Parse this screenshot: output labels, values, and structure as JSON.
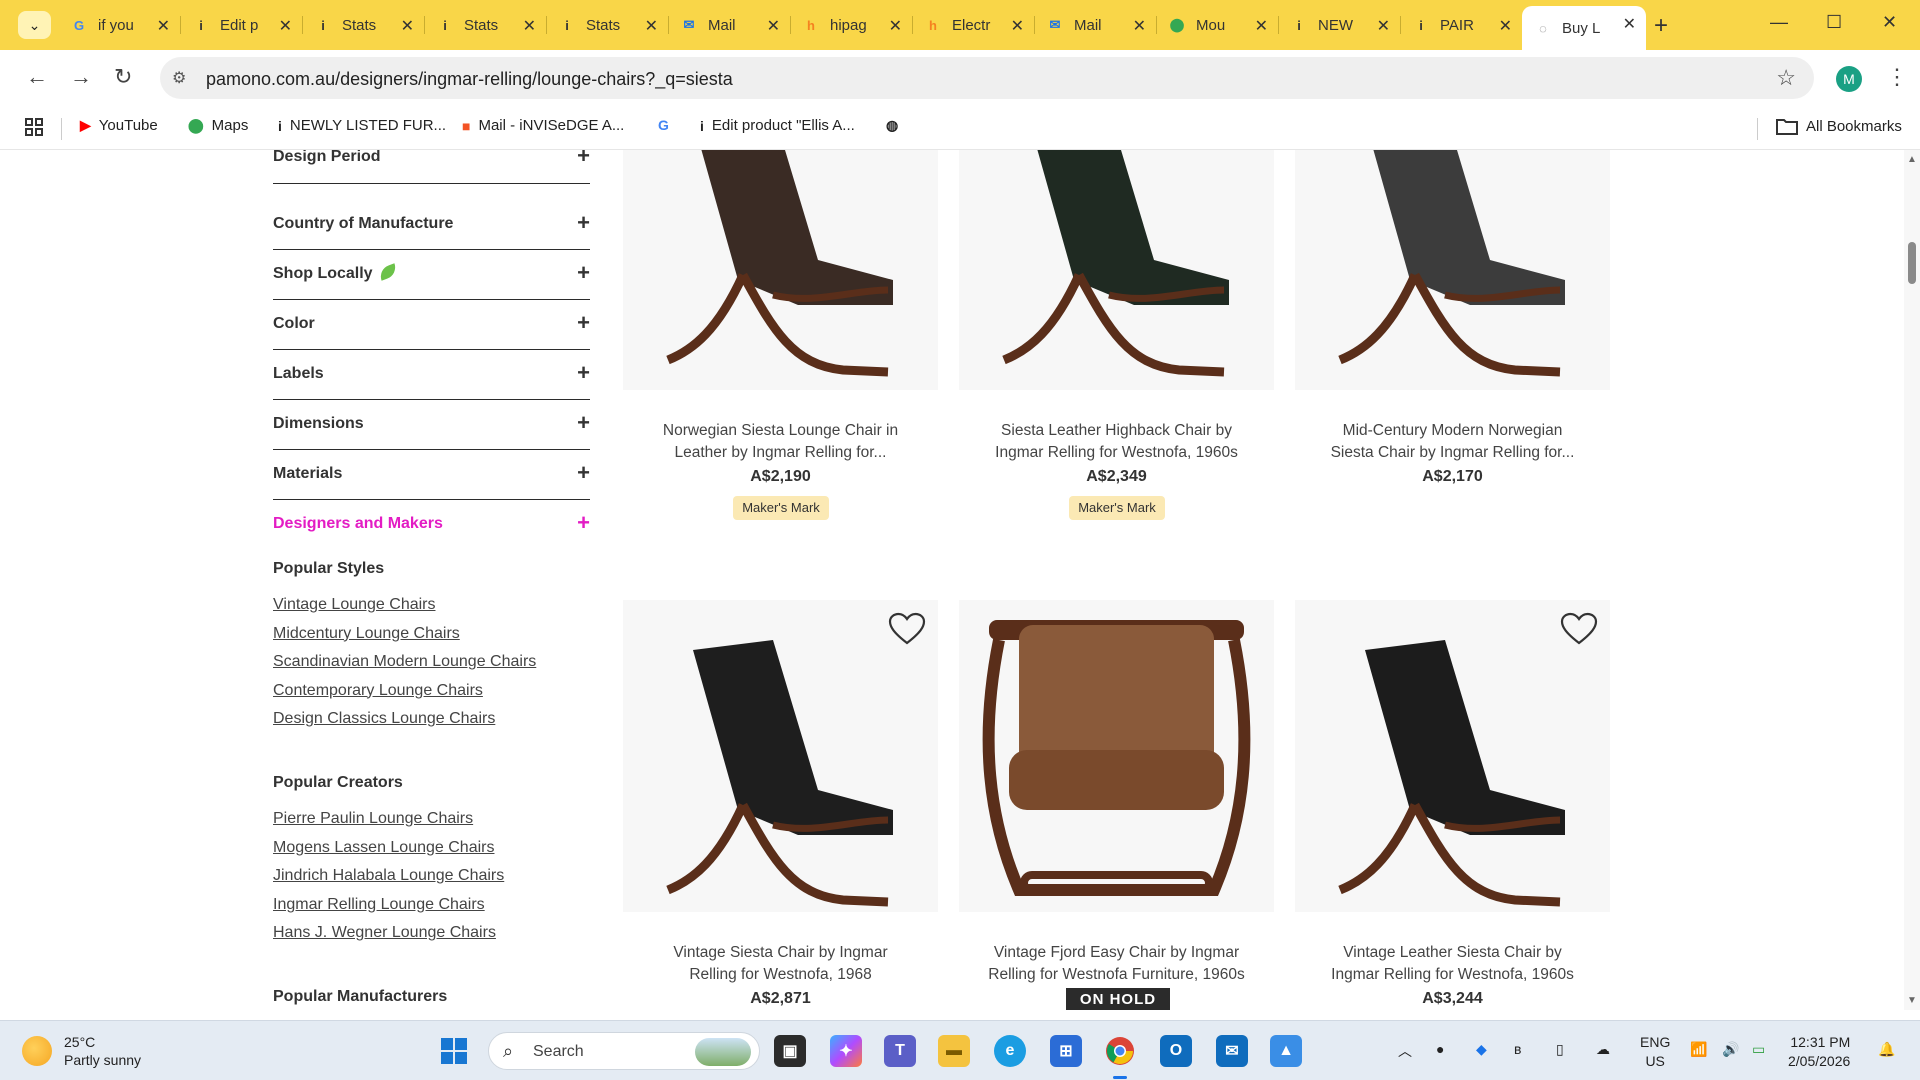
{
  "browser": {
    "tabs": [
      {
        "label": "if you",
        "icon": "google-icon",
        "color": "#4285f4",
        "glyph": "G"
      },
      {
        "label": "Edit p",
        "icon": "info-icon",
        "color": "#333333",
        "glyph": "i"
      },
      {
        "label": "Stats",
        "icon": "info-icon",
        "color": "#333333",
        "glyph": "i"
      },
      {
        "label": "Stats",
        "icon": "info-icon",
        "color": "#333333",
        "glyph": "i"
      },
      {
        "label": "Stats",
        "icon": "info-icon",
        "color": "#333333",
        "glyph": "i"
      },
      {
        "label": "Mail",
        "icon": "outlook-icon",
        "color": "#1a73e8",
        "glyph": "✉"
      },
      {
        "label": "hipag",
        "icon": "hipages-icon",
        "color": "#f58220",
        "glyph": "h"
      },
      {
        "label": "Electr",
        "icon": "hipages-icon",
        "color": "#f58220",
        "glyph": "h"
      },
      {
        "label": "Mail",
        "icon": "outlook-icon",
        "color": "#1a73e8",
        "glyph": "✉"
      },
      {
        "label": "Mou",
        "icon": "maps-icon",
        "color": "#34a853",
        "glyph": "⬤"
      },
      {
        "label": "NEW",
        "icon": "info-icon",
        "color": "#333333",
        "glyph": "i"
      },
      {
        "label": "PAIR",
        "icon": "info-icon",
        "color": "#333333",
        "glyph": "i"
      },
      {
        "label": "Buy L",
        "icon": "loading-icon",
        "color": "#777777",
        "glyph": "◌"
      }
    ],
    "url": "pamono.com.au/designers/ingmar-relling/lounge-chairs?_q=siesta",
    "profile_initial": "M",
    "bookmarks": [
      {
        "label": "YouTube",
        "icon": "youtube-icon"
      },
      {
        "label": "Maps",
        "icon": "maps-icon"
      },
      {
        "label": "NEWLY LISTED FUR...",
        "icon": "info-icon"
      },
      {
        "label": "Mail - iNVISeDGE A...",
        "icon": "microsoft-icon"
      },
      {
        "label": "",
        "icon": "google-icon"
      },
      {
        "label": "Edit product \"Ellis A...",
        "icon": "info-icon"
      },
      {
        "label": "",
        "icon": "globe-icon"
      }
    ],
    "all_bookmarks": "All Bookmarks"
  },
  "sidebar": {
    "filters": [
      {
        "label": "Design Period"
      },
      {
        "label": "Country of Manufacture"
      },
      {
        "label": "Shop Locally"
      },
      {
        "label": "Color"
      },
      {
        "label": "Labels"
      },
      {
        "label": "Dimensions"
      },
      {
        "label": "Materials"
      },
      {
        "label": "Designers and Makers",
        "active": true
      }
    ],
    "popular_styles_title": "Popular Styles",
    "popular_styles": [
      "Vintage Lounge Chairs",
      "Midcentury Lounge Chairs",
      "Scandinavian Modern Lounge Chairs",
      "Contemporary Lounge Chairs",
      "Design Classics Lounge Chairs"
    ],
    "popular_creators_title": "Popular Creators",
    "popular_creators": [
      "Pierre Paulin Lounge Chairs",
      "Mogens Lassen Lounge Chairs",
      "Jindrich Halabala Lounge Chairs",
      "Ingmar Relling Lounge Chairs",
      "Hans J. Wegner Lounge Chairs"
    ],
    "popular_manufacturers_title": "Popular Manufacturers"
  },
  "products": [
    {
      "title_line1": "Norwegian Siesta Lounge Chair in",
      "title_line2": "Leather by Ingmar Relling for...",
      "price": "A$2,190",
      "badge": "Maker's Mark",
      "leather": "#3a2b24"
    },
    {
      "title_line1": "Siesta Leather Highback Chair by",
      "title_line2": "Ingmar Relling for Westnofa, 1960s",
      "price": "A$2,349",
      "badge": "Maker's Mark",
      "leather": "#1f2a22"
    },
    {
      "title_line1": "Mid-Century Modern Norwegian",
      "title_line2": "Siesta Chair by Ingmar Relling for...",
      "price": "A$2,170",
      "badge": "",
      "leather": "#3c3c3c"
    },
    {
      "title_line1": "Vintage Siesta Chair by Ingmar",
      "title_line2": "Relling for Westnofa, 1968",
      "price": "A$2,871",
      "badge": "",
      "leather": "#1e1e1e"
    },
    {
      "title_line1": "Vintage Fjord Easy Chair by Ingmar",
      "title_line2": "Relling for Westnofa Furniture, 1960s",
      "price": "",
      "badge": "ON HOLD",
      "leather": "#8a5a3a"
    },
    {
      "title_line1": "Vintage Leather Siesta Chair by",
      "title_line2": "Ingmar Relling for Westnofa, 1960s",
      "price": "A$3,244",
      "badge": "",
      "leather": "#1c1c1c"
    }
  ],
  "taskbar": {
    "temp": "25°C",
    "condition": "Partly sunny",
    "search": "Search",
    "lang1": "ENG",
    "lang2": "US",
    "time": "12:31 PM",
    "date": "2/05/2026"
  },
  "colors": {
    "chrome_frame": "#f9d648",
    "accent_active_filter": "#e31cc4",
    "badge_bg": "#fbe9b4"
  }
}
